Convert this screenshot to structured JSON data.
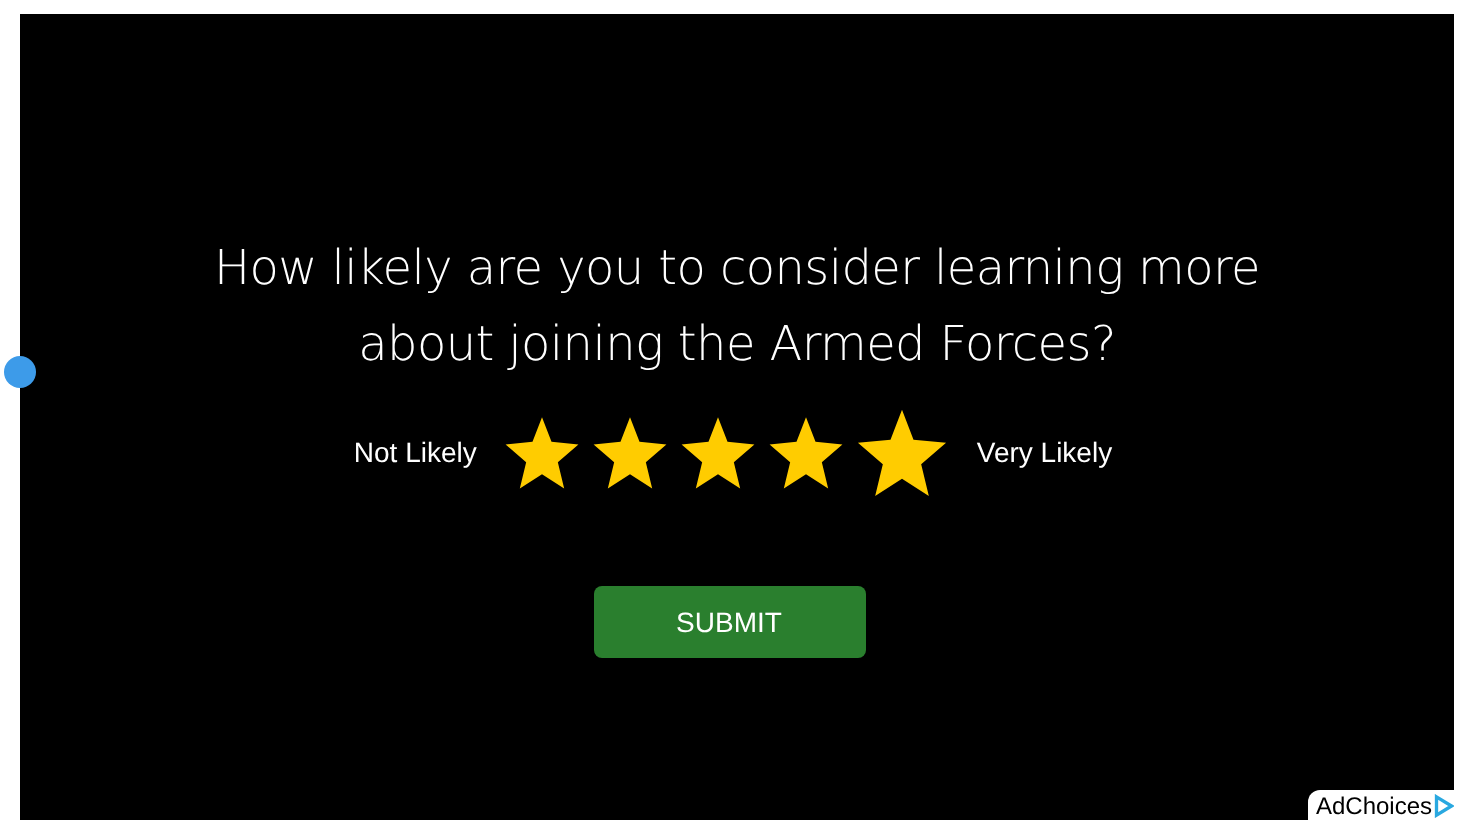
{
  "survey": {
    "question": "How likely are you to consider learning more about joining the Armed Forces?",
    "low_label": "Not Likely",
    "high_label": "Very Likely",
    "stars": 5,
    "submit": "SUBMIT"
  },
  "ad_badge": {
    "label": "AdChoices"
  }
}
